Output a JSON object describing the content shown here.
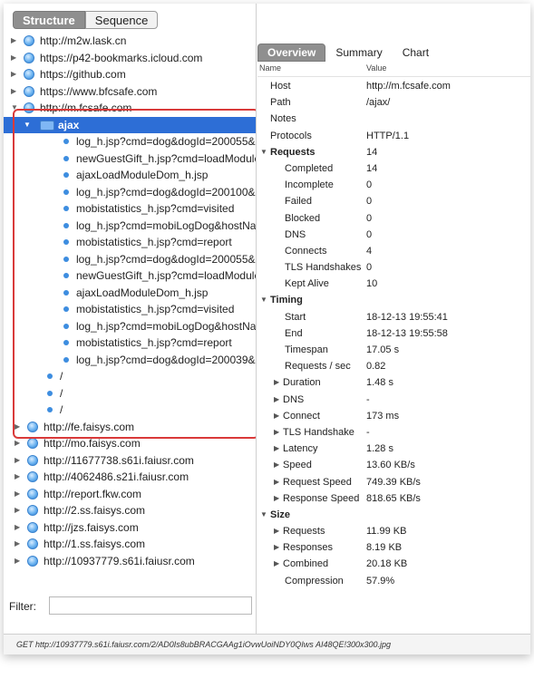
{
  "left": {
    "segments": [
      "Structure",
      "Sequence"
    ],
    "hosts_top": [
      "http://m2w.lask.cn",
      "https://p42-bookmarks.icloud.com",
      "https://github.com",
      "https://www.bfcsafe.com"
    ],
    "expanded_host": "http://m.fcsafe.com",
    "selected_folder": "ajax",
    "ajax_children": [
      "log_h.jsp?cmd=dog&dogId=200055&de",
      "newGuestGift_h.jsp?cmd=loadModuleD",
      "ajaxLoadModuleDom_h.jsp",
      "log_h.jsp?cmd=dog&dogId=200100&de",
      "mobistatistics_h.jsp?cmd=visited",
      "log_h.jsp?cmd=mobiLogDog&hostName",
      "mobistatistics_h.jsp?cmd=report",
      "log_h.jsp?cmd=dog&dogId=200055&de",
      "newGuestGift_h.jsp?cmd=loadModuleD",
      "ajaxLoadModuleDom_h.jsp",
      "mobistatistics_h.jsp?cmd=visited",
      "log_h.jsp?cmd=mobiLogDog&hostName",
      "mobistatistics_h.jsp?cmd=report",
      "log_h.jsp?cmd=dog&dogId=200039&d"
    ],
    "root_children": [
      "/",
      "/",
      "/"
    ],
    "hosts_bottom": [
      "http://fe.faisys.com",
      "http://mo.faisys.com",
      "http://11677738.s61i.faiusr.com",
      "http://4062486.s21i.faiusr.com",
      "http://report.fkw.com",
      "http://2.ss.faisys.com",
      "http://jzs.faisys.com",
      "http://1.ss.faisys.com",
      "http://10937779.s61i.faiusr.com"
    ],
    "filter_label": "Filter:",
    "filter_value": ""
  },
  "status_text": "GET http://10937779.s61i.faiusr.com/2/AD0Is8ubBRACGAAg1iOvwUoiNDY0QIws AI48QE!300x300.jpg",
  "right": {
    "tabs": [
      "Overview",
      "Summary",
      "Chart"
    ],
    "col_name": "Name",
    "col_value": "Value",
    "rows": [
      {
        "name": "Host",
        "value": "http://m.fcsafe.com",
        "level": 0
      },
      {
        "name": "Path",
        "value": "/ajax/",
        "level": 0
      },
      {
        "name": "Notes",
        "value": "",
        "level": 0
      },
      {
        "name": "Protocols",
        "value": "HTTP/1.1",
        "level": 0
      },
      {
        "name": "Requests",
        "value": "14",
        "level": 0,
        "section": true
      },
      {
        "name": "Completed",
        "value": "14",
        "level": 1
      },
      {
        "name": "Incomplete",
        "value": "0",
        "level": 1
      },
      {
        "name": "Failed",
        "value": "0",
        "level": 1
      },
      {
        "name": "Blocked",
        "value": "0",
        "level": 1
      },
      {
        "name": "DNS",
        "value": "0",
        "level": 1
      },
      {
        "name": "Connects",
        "value": "4",
        "level": 1
      },
      {
        "name": "TLS Handshakes",
        "value": "0",
        "level": 1
      },
      {
        "name": "Kept Alive",
        "value": "10",
        "level": 1
      },
      {
        "name": "Timing",
        "value": "",
        "level": 0,
        "section": true
      },
      {
        "name": "Start",
        "value": "18-12-13 19:55:41",
        "level": 1
      },
      {
        "name": "End",
        "value": "18-12-13 19:55:58",
        "level": 1
      },
      {
        "name": "Timespan",
        "value": "17.05 s",
        "level": 1
      },
      {
        "name": "Requests / sec",
        "value": "0.82",
        "level": 1
      },
      {
        "name": "Duration",
        "value": "1.48 s",
        "level": 1,
        "expandable": true
      },
      {
        "name": "DNS",
        "value": "-",
        "level": 1,
        "expandable": true
      },
      {
        "name": "Connect",
        "value": "173 ms",
        "level": 1,
        "expandable": true
      },
      {
        "name": "TLS Handshake",
        "value": "-",
        "level": 1,
        "expandable": true
      },
      {
        "name": "Latency",
        "value": "1.28 s",
        "level": 1,
        "expandable": true
      },
      {
        "name": "Speed",
        "value": "13.60 KB/s",
        "level": 1,
        "expandable": true
      },
      {
        "name": "Request Speed",
        "value": "749.39 KB/s",
        "level": 1,
        "expandable": true
      },
      {
        "name": "Response Speed",
        "value": "818.65 KB/s",
        "level": 1,
        "expandable": true
      },
      {
        "name": "Size",
        "value": "",
        "level": 0,
        "section": true
      },
      {
        "name": "Requests",
        "value": "11.99 KB",
        "level": 1,
        "expandable": true
      },
      {
        "name": "Responses",
        "value": "8.19 KB",
        "level": 1,
        "expandable": true
      },
      {
        "name": "Combined",
        "value": "20.18 KB",
        "level": 1,
        "expandable": true
      },
      {
        "name": "Compression",
        "value": "57.9%",
        "level": 1
      }
    ]
  },
  "colors": {
    "selection": "#2d6ed6",
    "highlight_box": "#d93a3a",
    "active_tab": "#8f8f8f"
  }
}
